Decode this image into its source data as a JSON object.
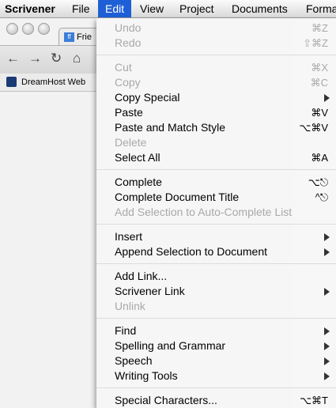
{
  "menubar": {
    "app": "Scrivener",
    "items": [
      "File",
      "Edit",
      "View",
      "Project",
      "Documents",
      "Format"
    ],
    "active_index": 1
  },
  "browser": {
    "tab_label": "Frie",
    "bookmark_label": "DreamHost Web"
  },
  "edit_menu": {
    "undo": {
      "label": "Undo",
      "shortcut": "⌘Z"
    },
    "redo": {
      "label": "Redo",
      "shortcut": "⇧⌘Z"
    },
    "cut": {
      "label": "Cut",
      "shortcut": "⌘X"
    },
    "copy": {
      "label": "Copy",
      "shortcut": "⌘C"
    },
    "copy_special": {
      "label": "Copy Special"
    },
    "paste": {
      "label": "Paste",
      "shortcut": "⌘V"
    },
    "paste_match": {
      "label": "Paste and Match Style",
      "shortcut": "⌥⌘V"
    },
    "delete": {
      "label": "Delete"
    },
    "select_all": {
      "label": "Select All",
      "shortcut": "⌘A"
    },
    "complete": {
      "label": "Complete",
      "shortcut": "⌥⎋"
    },
    "complete_doc_title": {
      "label": "Complete Document Title",
      "shortcut": "^⎋"
    },
    "add_selection": {
      "label": "Add Selection to Auto-Complete List"
    },
    "insert": {
      "label": "Insert"
    },
    "append_selection": {
      "label": "Append Selection to Document"
    },
    "add_link": {
      "label": "Add Link..."
    },
    "scrivener_link": {
      "label": "Scrivener Link"
    },
    "unlink": {
      "label": "Unlink"
    },
    "find": {
      "label": "Find"
    },
    "spelling_grammar": {
      "label": "Spelling and Grammar"
    },
    "speech": {
      "label": "Speech"
    },
    "writing_tools": {
      "label": "Writing Tools"
    },
    "special_characters": {
      "label": "Special Characters...",
      "shortcut": "⌥⌘T"
    }
  }
}
